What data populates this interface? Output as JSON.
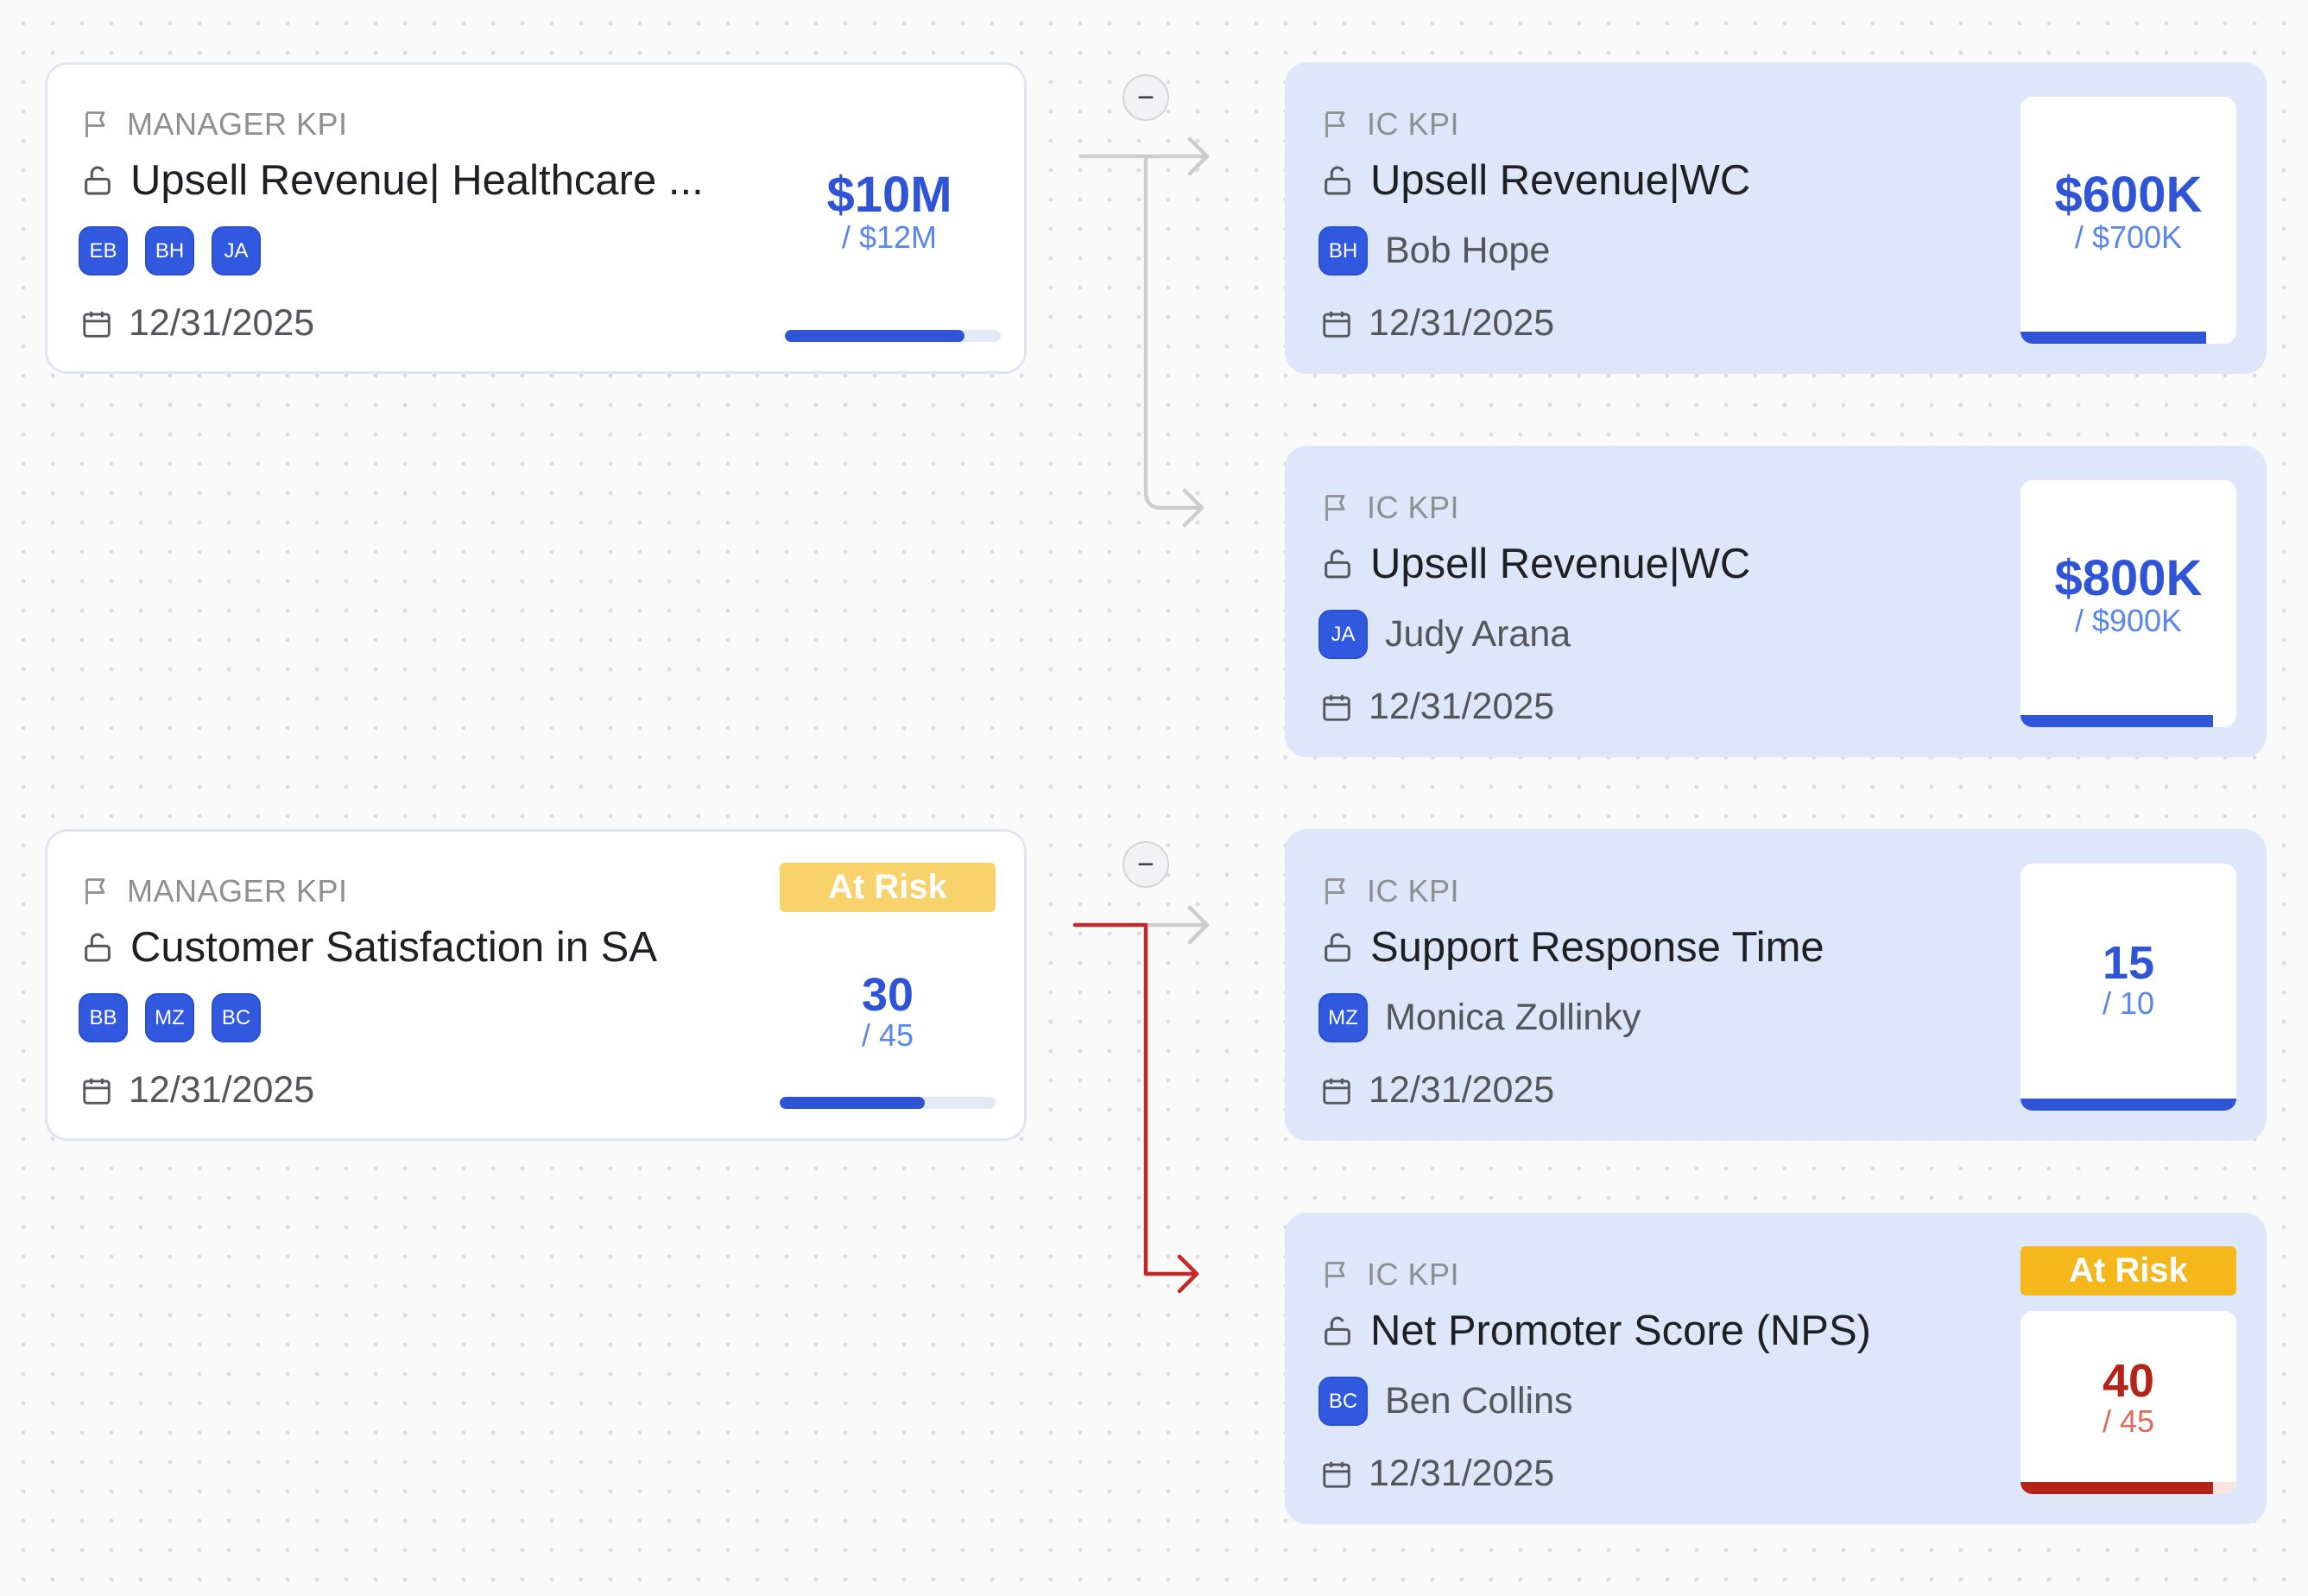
{
  "colors": {
    "accent_blue": "#2f54d6",
    "target_blue": "#5a86ea",
    "risk_red": "#b42318",
    "risk_badge_light": "#f8d36b",
    "risk_badge_dark": "#f4b81c",
    "connector_grey": "#cdcdcd",
    "connector_red": "#c62828"
  },
  "groups": [
    {
      "manager": {
        "kind": "MANAGER KPI",
        "title": "Upsell Revenue| Healthcare ...",
        "owners": [
          "EB",
          "BH",
          "JA"
        ],
        "date": "12/31/2025",
        "value": "$10M",
        "target": "/ $12M",
        "progress": 0.83,
        "status": null
      },
      "collapse_label": "−",
      "children": [
        {
          "kind": "IC KPI",
          "title": "Upsell Revenue|WC",
          "owner_initials": "BH",
          "owner_name": "Bob Hope",
          "date": "12/31/2025",
          "value": "$600K",
          "target": "/ $700K",
          "progress": 0.86,
          "status": null
        },
        {
          "kind": "IC KPI",
          "title": "Upsell Revenue|WC",
          "owner_initials": "JA",
          "owner_name": "Judy Arana",
          "date": "12/31/2025",
          "value": "$800K",
          "target": "/ $900K",
          "progress": 0.89,
          "status": null
        }
      ]
    },
    {
      "manager": {
        "kind": "MANAGER KPI",
        "title": "Customer Satisfaction in SA",
        "owners": [
          "BB",
          "MZ",
          "BC"
        ],
        "date": "12/31/2025",
        "value": "30",
        "target": "/ 45",
        "progress": 0.67,
        "status": "At Risk"
      },
      "collapse_label": "−",
      "children": [
        {
          "kind": "IC KPI",
          "title": "Support Response Time",
          "owner_initials": "MZ",
          "owner_name": "Monica Zollinky",
          "date": "12/31/2025",
          "value": "15",
          "target": "/ 10",
          "progress": 1.0,
          "status": null
        },
        {
          "kind": "IC KPI",
          "title": "Net Promoter Score (NPS)",
          "owner_initials": "BC",
          "owner_name": "Ben Collins",
          "date": "12/31/2025",
          "value": "40",
          "target": "/ 45",
          "progress": 0.89,
          "status": "At Risk"
        }
      ]
    }
  ]
}
